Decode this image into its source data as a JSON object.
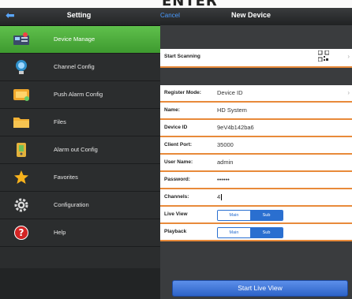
{
  "top_banner": "ENTER",
  "left_panel": {
    "title": "Setting",
    "items": [
      {
        "label": "Device Manage",
        "icon": "device-manage-icon",
        "active": true
      },
      {
        "label": "Channel Config",
        "icon": "channel-config-icon",
        "active": false
      },
      {
        "label": "Push Alarm Config",
        "icon": "push-alarm-icon",
        "active": false
      },
      {
        "label": "Files",
        "icon": "folder-icon",
        "active": false
      },
      {
        "label": "Alarm out Config",
        "icon": "alarm-out-icon",
        "active": false
      },
      {
        "label": "Favorites",
        "icon": "star-icon",
        "active": false
      },
      {
        "label": "Configuration",
        "icon": "gear-icon",
        "active": false
      },
      {
        "label": "Help",
        "icon": "help-icon",
        "active": false
      }
    ]
  },
  "right_panel": {
    "cancel": "Cancel",
    "title": "New Device",
    "start_scanning": "Start Scanning",
    "fields": {
      "register_mode": {
        "label": "Register Mode:",
        "value": "Device ID"
      },
      "name": {
        "label": "Name:",
        "value": "HD System"
      },
      "device_id": {
        "label": "Device ID",
        "value": "9eV4b142ba6"
      },
      "client_port": {
        "label": "Client Port:",
        "value": "35000"
      },
      "user_name": {
        "label": "User Name:",
        "value": "admin"
      },
      "password": {
        "label": "Password:",
        "value": "••••••"
      },
      "channels": {
        "label": "Channels:",
        "value": "4"
      }
    },
    "live_view": {
      "label": "Live View",
      "options": [
        "Main",
        "Sub"
      ],
      "selected": "Sub"
    },
    "playback": {
      "label": "Playback",
      "options": [
        "Main",
        "Sub"
      ],
      "selected": "Sub"
    },
    "start_live_view": "Start Live View"
  }
}
